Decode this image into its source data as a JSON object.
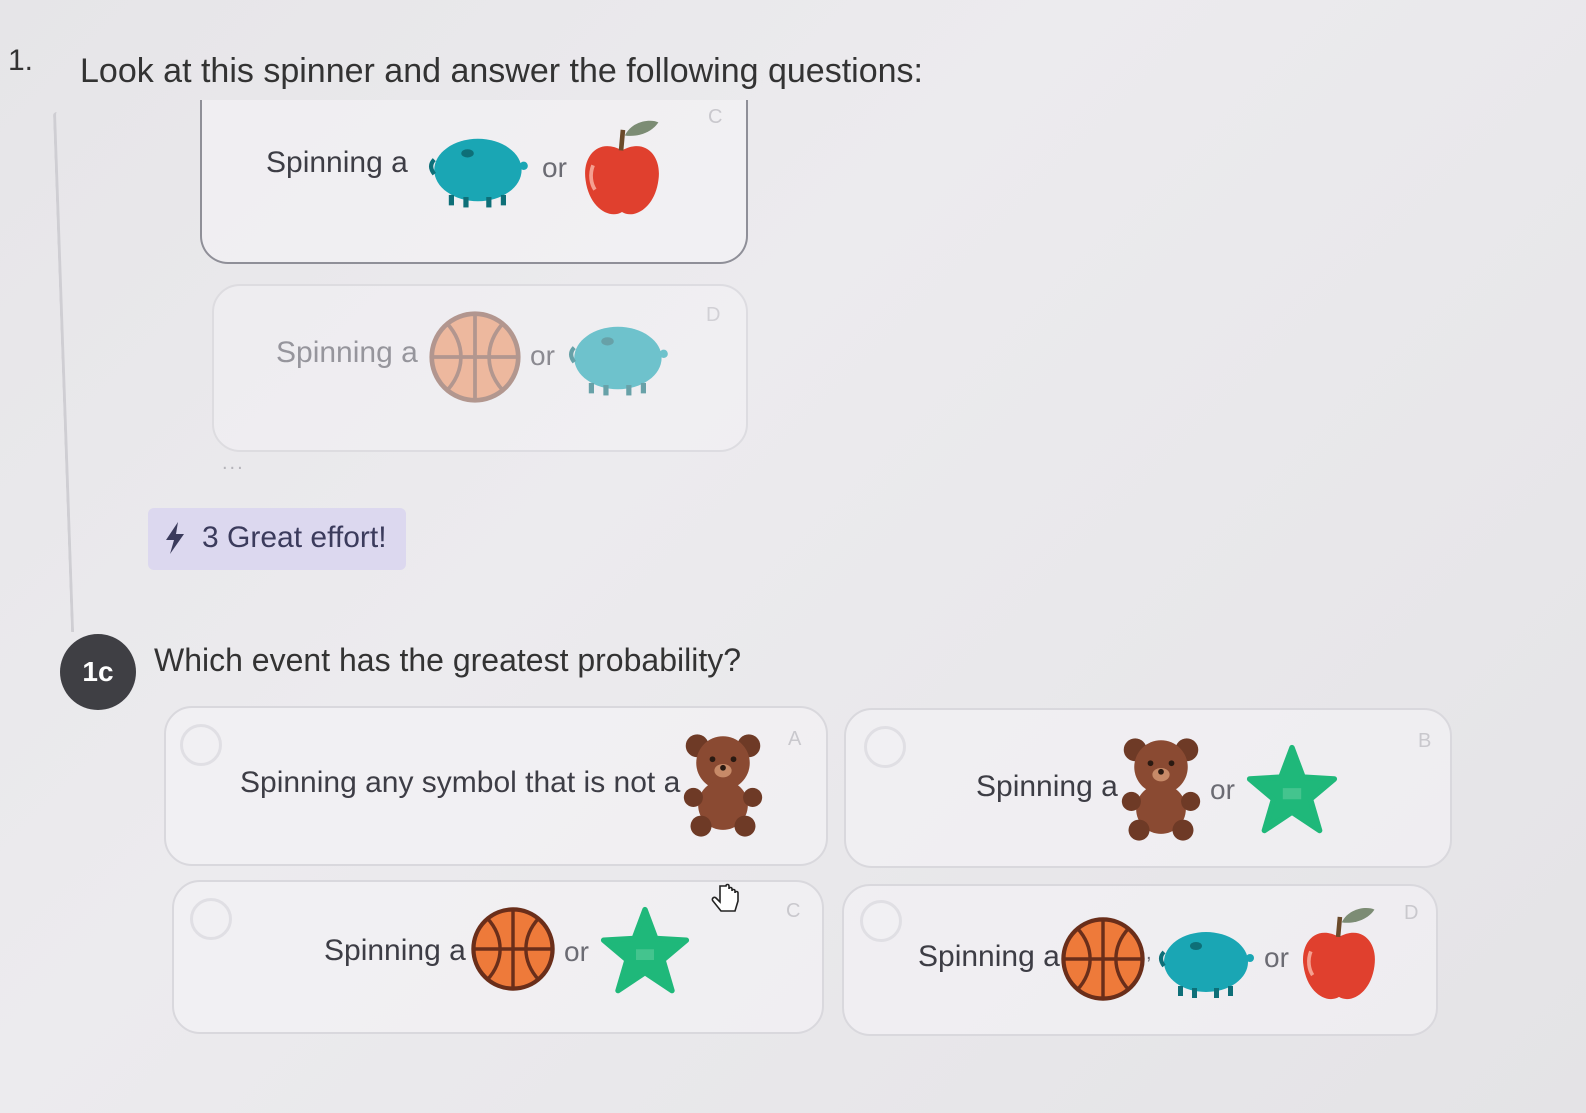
{
  "question_number": "1.",
  "prompt": "Look at this spinner and answer the following questions:",
  "previous_options": [
    {
      "text": "Spinning a",
      "connector": "or",
      "letter": "C",
      "icons": [
        "pig-icon",
        "apple-icon"
      ]
    },
    {
      "text": "Spinning a",
      "connector": "or",
      "letter": "D",
      "icons": [
        "basketball-icon",
        "pig-icon"
      ]
    }
  ],
  "ellipsis": "...",
  "feedback": {
    "count": "3",
    "message": "Great effort!",
    "label": "3 Great effort!"
  },
  "step": {
    "label": "1c",
    "question": "Which event has the greatest probability?"
  },
  "options": [
    {
      "letter": "A",
      "text": "Spinning any symbol that is not a",
      "icons": [
        "bear-icon"
      ]
    },
    {
      "letter": "B",
      "text": "Spinning a",
      "connector": "or",
      "icons": [
        "bear-icon",
        "star-icon"
      ]
    },
    {
      "letter": "C",
      "text": "Spinning a",
      "connector": "or",
      "icons": [
        "basketball-icon",
        "star-icon"
      ]
    },
    {
      "letter": "D",
      "text": "Spinning a",
      "connector": "or",
      "separator": ",",
      "icons": [
        "basketball-icon",
        "pig-icon",
        "apple-icon"
      ]
    }
  ],
  "colors": {
    "pig": "#1aa6b4",
    "apple": "#e0402e",
    "basketball": "#ee7a3a",
    "bear": "#8a4a32",
    "star": "#1fb87a",
    "badge_bg": "#dcd8ef",
    "step_bg": "#3f3f44"
  }
}
